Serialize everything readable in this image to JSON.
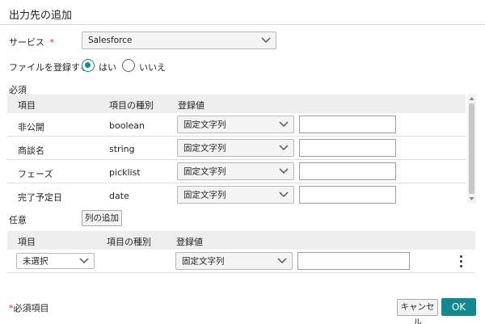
{
  "dialog": {
    "title": "出力先の追加"
  },
  "service": {
    "label": "サービス",
    "required_mark": "*",
    "value": "Salesforce"
  },
  "register_file": {
    "label": "ファイルを登録する",
    "options": [
      "はい",
      "いいえ"
    ],
    "selected": "はい"
  },
  "required_section": {
    "label": "必須",
    "columns": [
      "項目",
      "項目の種別",
      "登録値"
    ],
    "rows": [
      {
        "name": "非公開",
        "type": "boolean",
        "value_type": "固定文字列",
        "value": ""
      },
      {
        "name": "商談名",
        "type": "string",
        "value_type": "固定文字列",
        "value": ""
      },
      {
        "name": "フェーズ",
        "type": "picklist",
        "value_type": "固定文字列",
        "value": ""
      },
      {
        "name": "完了予定日",
        "type": "date",
        "value_type": "固定文字列",
        "value": ""
      }
    ]
  },
  "optional_section": {
    "label": "任意",
    "add_column_label": "列の追加",
    "columns": [
      "項目",
      "項目の種別",
      "登録値"
    ],
    "rows": [
      {
        "name": "未選択",
        "type": "",
        "value_type": "固定文字列",
        "value": ""
      }
    ]
  },
  "footer": {
    "required_note_mark": "*",
    "required_note": "必須項目",
    "cancel_label": "キャンセル",
    "ok_label": "OK"
  },
  "colors": {
    "accent": "#11898f",
    "required": "#d9262b"
  },
  "icons": [
    "chevron-down-icon",
    "kebab-menu-icon",
    "scroll-up-icon",
    "scroll-down-icon"
  ]
}
